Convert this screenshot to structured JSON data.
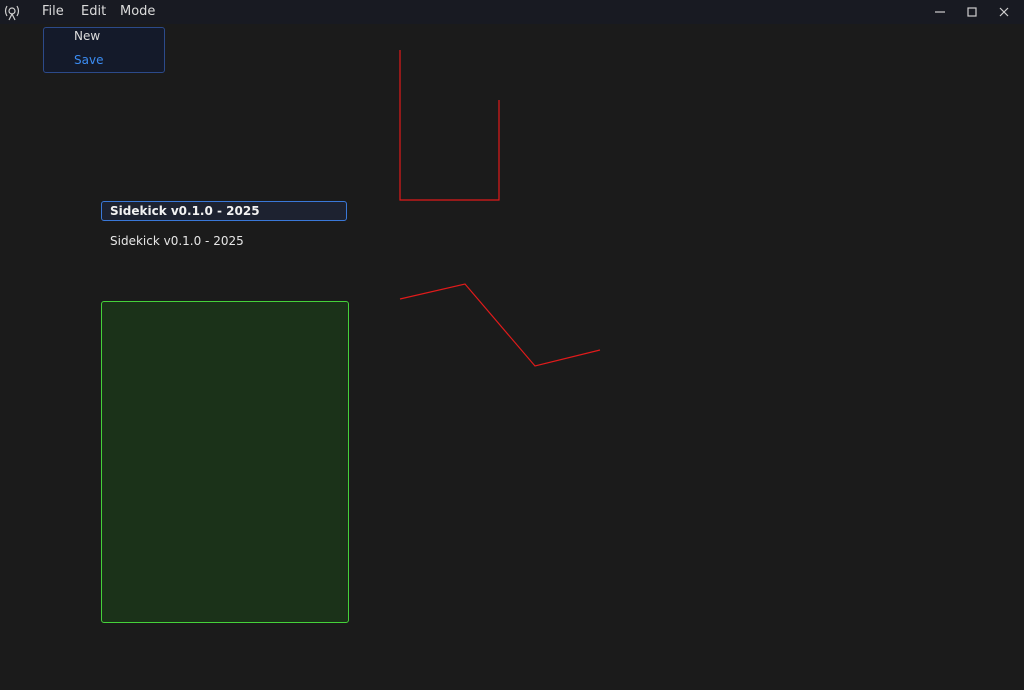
{
  "app": {
    "icon": "app-logo-icon"
  },
  "menubar": {
    "items": [
      {
        "id": "file",
        "label": "File"
      },
      {
        "id": "edit",
        "label": "Edit"
      },
      {
        "id": "mode",
        "label": "Mode"
      }
    ]
  },
  "window_controls": {
    "minimize": "minimize-icon",
    "maximize": "maximize-icon",
    "close": "close-icon"
  },
  "file_menu": {
    "items": [
      {
        "label": "New"
      },
      {
        "label": "Save",
        "highlighted": true
      }
    ],
    "highlight_color": "#3b8cf2"
  },
  "version": {
    "field_value": "Sidekick v0.1.0 - 2025",
    "label": "Sidekick v0.1.0 - 2025"
  },
  "colors": {
    "background": "#1b1b1b",
    "accent": "#3a78d8",
    "stroke_red": "#e01b1b",
    "panel_green": "#45d23a"
  }
}
